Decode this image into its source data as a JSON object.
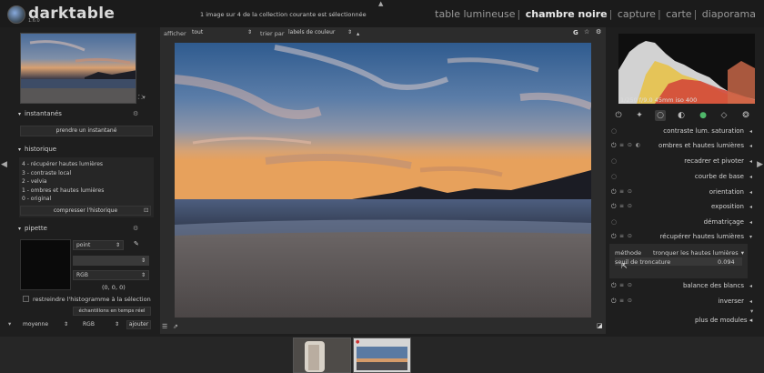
{
  "app": {
    "name": "darktable",
    "version": "1.6.0"
  },
  "topbar": {
    "status": "1 image sur 4 de la collection courante est sélectionnée"
  },
  "views": [
    {
      "label": "table lumineuse",
      "active": false
    },
    {
      "label": "chambre noire",
      "active": true
    },
    {
      "label": "capture",
      "active": false
    },
    {
      "label": "carte",
      "active": false
    },
    {
      "label": "diaporama",
      "active": false
    }
  ],
  "left": {
    "snapshots": {
      "title": "instantanés",
      "button": "prendre un instantané"
    },
    "history": {
      "title": "historique",
      "items": [
        "4 - récupérer hautes lumières",
        "3 - contraste local",
        "2 - velvia",
        "1 - ombres et hautes lumières",
        "0 - original"
      ],
      "compress": "compresser l'historique"
    },
    "pipette": {
      "title": "pipette",
      "mode": "point",
      "select2": "",
      "colorspace": "RGB",
      "value": "(0, 0, 0)",
      "restrict_label": "restreindre l'histogramme à la sélection",
      "live_samples": "échantillons en temps réel",
      "stat": "moyenne",
      "stat_space": "RGB",
      "add": "ajouter"
    }
  },
  "center": {
    "show_label": "afficher",
    "show_value": "tout",
    "sort_label": "trier par",
    "sort_value": "labels de couleur",
    "sort_dir": "▴",
    "g_label": "G"
  },
  "right": {
    "exif": "1/250 f/9.0 45mm iso 400",
    "modules": [
      {
        "name": "contraste lum. saturation",
        "arrow": "◂",
        "power": false
      },
      {
        "name": "ombres et hautes lumières",
        "arrow": "◂",
        "power": true
      },
      {
        "name": "recadrer et pivoter",
        "arrow": "◂",
        "power": false
      },
      {
        "name": "courbe de base",
        "arrow": "◂",
        "power": false
      },
      {
        "name": "orientation",
        "arrow": "◂",
        "power": true
      },
      {
        "name": "exposition",
        "arrow": "◂",
        "power": true
      },
      {
        "name": "dématriçage",
        "arrow": "◂",
        "power": false
      },
      {
        "name": "récupérer hautes lumières",
        "arrow": "▾",
        "power": true
      },
      {
        "name": "balance des blancs",
        "arrow": "◂",
        "power": true
      },
      {
        "name": "inverser",
        "arrow": "◂",
        "power": true
      }
    ],
    "expanded": {
      "method_label": "méthode",
      "method_value": "tronquer les hautes lumières",
      "threshold_label": "seuil de troncature",
      "threshold_value": "0.094"
    },
    "more_modules": "plus de modules"
  }
}
